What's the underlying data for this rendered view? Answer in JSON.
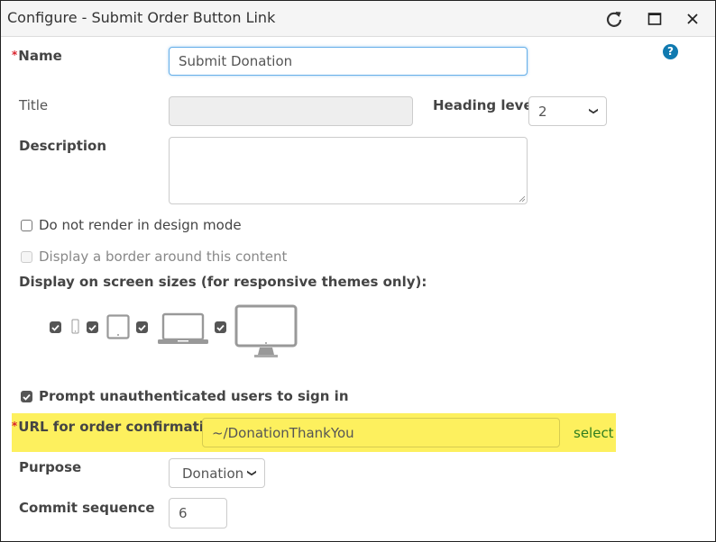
{
  "window": {
    "title": "Configure - Submit Order Button Link",
    "controls": {
      "refresh": "refresh-icon",
      "maximize": "maximize-icon",
      "close": "close-icon"
    }
  },
  "help": {
    "icon": "help-icon",
    "glyph": "?"
  },
  "required_marker": "*",
  "form": {
    "name": {
      "label": "Name",
      "required": true,
      "value": "Submit Donation"
    },
    "title": {
      "label": "Title",
      "value": "",
      "disabled": true
    },
    "heading_level": {
      "label": "Heading level",
      "value": "2"
    },
    "description": {
      "label": "Description",
      "value": ""
    },
    "do_not_render": {
      "label": "Do not render in design mode",
      "checked": false
    },
    "display_border": {
      "label": "Display a border around this content",
      "checked": false,
      "disabled": true
    },
    "screen_sizes": {
      "label": "Display on screen sizes (for responsive themes only):",
      "devices": [
        {
          "name": "phone",
          "icon": "phone-icon",
          "checked": true
        },
        {
          "name": "tablet",
          "icon": "tablet-icon",
          "checked": true
        },
        {
          "name": "laptop",
          "icon": "laptop-icon",
          "checked": true
        },
        {
          "name": "desktop",
          "icon": "desktop-icon",
          "checked": true
        }
      ]
    },
    "prompt_signin": {
      "label": "Prompt unauthenticated users to sign in",
      "checked": true
    },
    "url_confirmation": {
      "label": "URL for order confirmation",
      "required": true,
      "value": "~/DonationThankYou",
      "select_link": "select",
      "highlight_color": "#fdf05e"
    },
    "purpose": {
      "label": "Purpose",
      "value": "Donation"
    },
    "commit_sequence": {
      "label": "Commit sequence",
      "value": "6"
    }
  }
}
